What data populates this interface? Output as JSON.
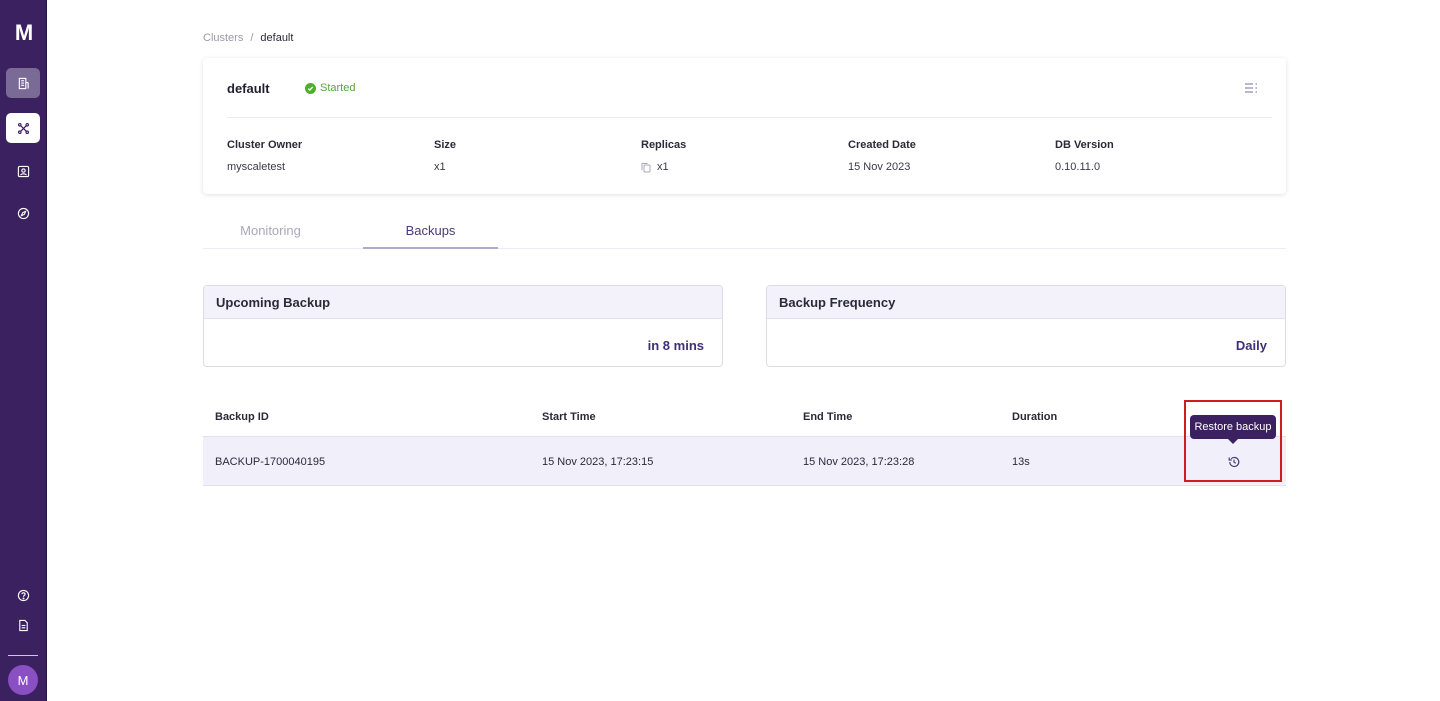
{
  "sidebar": {
    "logo": "M",
    "avatar_letter": "M",
    "items": [
      {
        "name": "clusters",
        "icon": "building-icon",
        "active": true
      },
      {
        "name": "connections",
        "icon": "network-icon",
        "active": false
      },
      {
        "name": "users",
        "icon": "user-card-icon",
        "active": false
      },
      {
        "name": "explore",
        "icon": "compass-icon",
        "active": false
      }
    ],
    "bottom_items": [
      {
        "name": "help",
        "icon": "help-circle-icon"
      },
      {
        "name": "docs",
        "icon": "document-icon"
      }
    ]
  },
  "breadcrumb": {
    "parent": "Clusters",
    "separator": "/",
    "current": "default"
  },
  "cluster": {
    "name": "default",
    "status": "Started",
    "status_color": "#4fae2d",
    "fields": [
      {
        "label": "Cluster Owner",
        "value": "myscaletest"
      },
      {
        "label": "Size",
        "value": "x1"
      },
      {
        "label": "Replicas",
        "value": "x1",
        "icon": "copy-icon"
      },
      {
        "label": "Created Date",
        "value": "15 Nov 2023"
      },
      {
        "label": "DB Version",
        "value": "0.10.11.0"
      }
    ]
  },
  "tabs": [
    {
      "label": "Monitoring",
      "active": false
    },
    {
      "label": "Backups",
      "active": true
    }
  ],
  "panels": {
    "upcoming": {
      "title": "Upcoming Backup",
      "value": "in 8 mins"
    },
    "frequency": {
      "title": "Backup Frequency",
      "value": "Daily"
    }
  },
  "table": {
    "columns": [
      "Backup ID",
      "Start Time",
      "End Time",
      "Duration"
    ],
    "rows": [
      {
        "backup_id": "BACKUP-1700040195",
        "start_time": "15 Nov 2023, 17:23:15",
        "end_time": "15 Nov 2023, 17:23:28",
        "duration": "13s",
        "action_icon": "restore-icon"
      }
    ]
  },
  "tooltip": {
    "text": "Restore backup"
  },
  "colors": {
    "sidebar": "#3b2160",
    "accent": "#3f2f7a",
    "row_highlight": "#f1effa",
    "annotation": "#cc1e1e"
  }
}
